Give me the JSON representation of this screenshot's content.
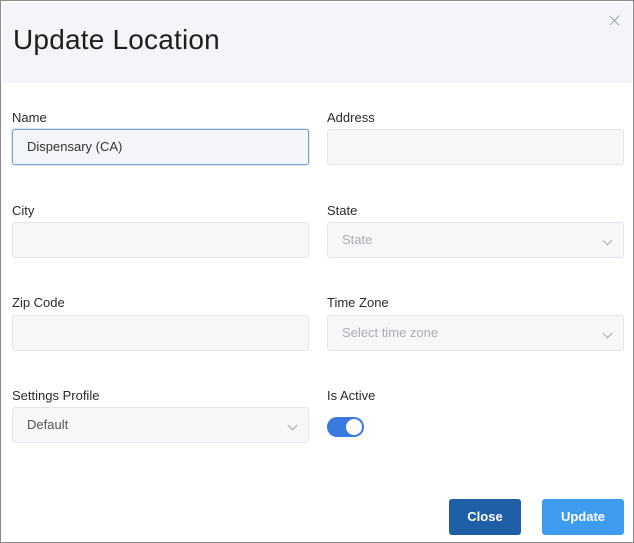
{
  "dialog": {
    "title": "Update Location",
    "close_icon": "close-icon"
  },
  "form": {
    "name": {
      "label": "Name",
      "value": "Dispensary (CA)"
    },
    "address": {
      "label": "Address",
      "value": ""
    },
    "city": {
      "label": "City",
      "value": ""
    },
    "state": {
      "label": "State",
      "placeholder": "State"
    },
    "zip": {
      "label": "Zip Code",
      "value": ""
    },
    "time_zone": {
      "label": "Time Zone",
      "placeholder": "Select time zone"
    },
    "settings_profile": {
      "label": "Settings Profile",
      "value": "Default"
    },
    "is_active": {
      "label": "Is Active",
      "checked": true
    }
  },
  "buttons": {
    "close_label": "Close",
    "update_label": "Update"
  },
  "colors": {
    "primary": "#3a79e0",
    "close_button": "#1e5fa8",
    "update_button": "#3d9cf0",
    "header_bg": "#f3f5f9"
  }
}
